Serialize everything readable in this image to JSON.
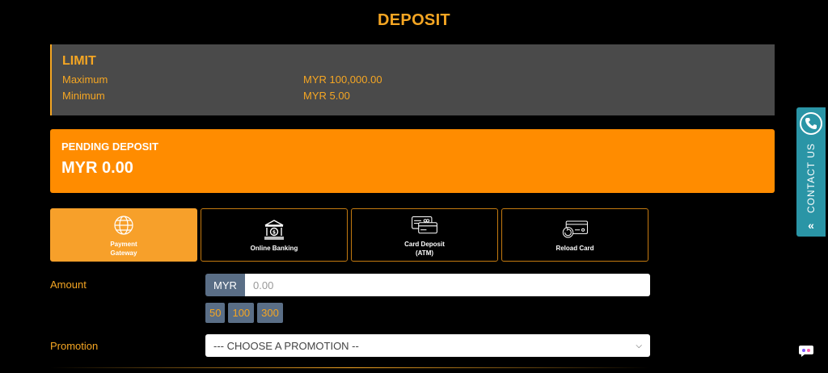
{
  "page": {
    "title": "DEPOSIT"
  },
  "limit": {
    "title": "LIMIT",
    "rows": [
      {
        "label": "Maximum",
        "value": "MYR 100,000.00"
      },
      {
        "label": "Minimum",
        "value": "MYR 5.00"
      }
    ]
  },
  "pending": {
    "title": "PENDING DEPOSIT",
    "amount": "MYR 0.00"
  },
  "methods": [
    {
      "label": "Payment\nGateway",
      "icon": "globe-icon",
      "active": true
    },
    {
      "label": "Online Banking",
      "icon": "bank-icon",
      "active": false
    },
    {
      "label": "Card Deposit\n(ATM)",
      "icon": "card-deposit-icon",
      "active": false
    },
    {
      "label": "Reload Card",
      "icon": "reload-card-icon",
      "active": false
    }
  ],
  "amount": {
    "label": "Amount",
    "currency": "MYR",
    "placeholder": "0.00",
    "quick": [
      "50",
      "100",
      "300"
    ]
  },
  "promotion": {
    "label": "Promotion",
    "selected": "--- CHOOSE A PROMOTION --"
  },
  "contact": {
    "label": "CONTACT US"
  },
  "colors": {
    "accent": "#f5a623",
    "pending_bg": "#ff8c00",
    "limit_bg": "#4a4a4a",
    "contact_bg": "#2a95a6",
    "addon_bg": "#5a6e86"
  }
}
